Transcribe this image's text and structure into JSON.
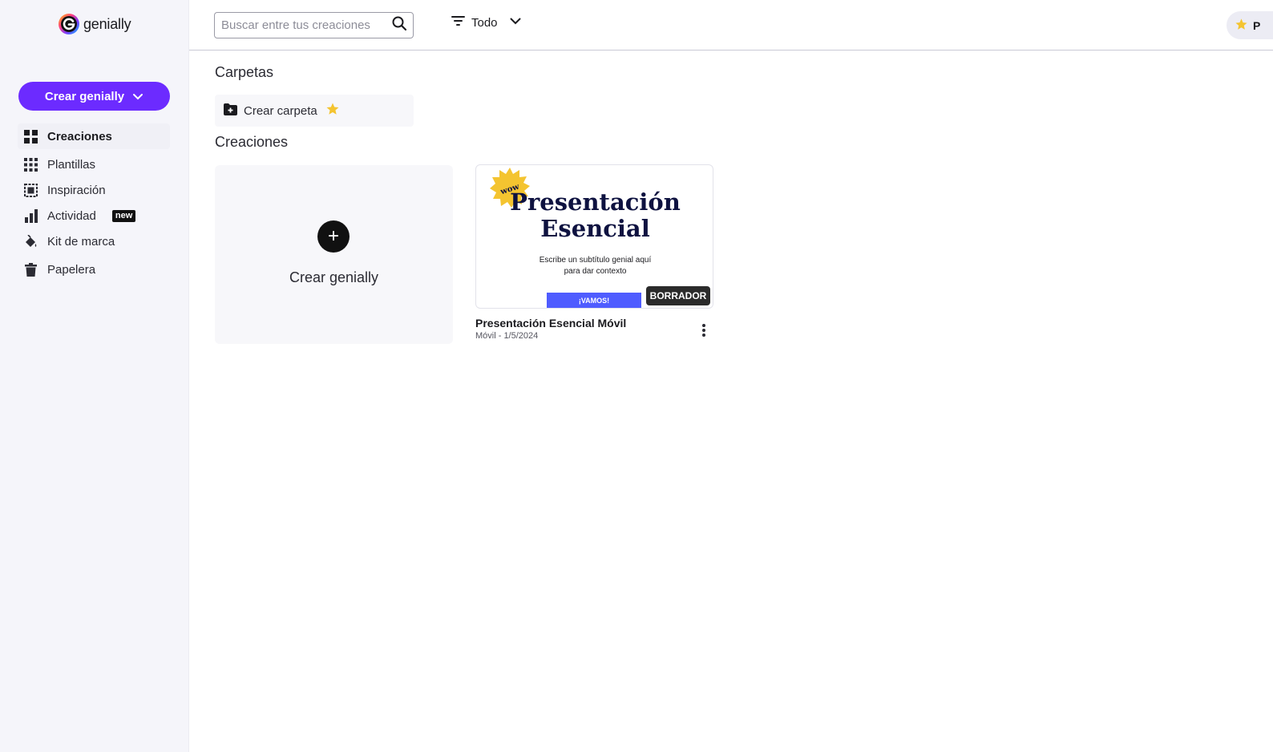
{
  "brand": {
    "name": "genially",
    "icon": "genially-logo-icon"
  },
  "sidebar": {
    "create_button": {
      "label": "Crear genially",
      "icon": "chevron-down-icon"
    },
    "items": [
      {
        "label": "Creaciones",
        "icon": "grid-icon",
        "active": true
      },
      {
        "label": "Plantillas",
        "icon": "dots-grid-icon"
      },
      {
        "label": "Inspiración",
        "icon": "gallery-icon"
      },
      {
        "label": "Actividad",
        "icon": "bar-chart-icon",
        "badge": "new"
      },
      {
        "label": "Kit de marca",
        "icon": "paint-bucket-icon"
      },
      {
        "label": "Papelera",
        "icon": "trash-icon"
      }
    ]
  },
  "topbar": {
    "search": {
      "placeholder": "Buscar entre tus creaciones",
      "value": ""
    },
    "filter": {
      "label": "Todo",
      "icon": "filter-icon"
    },
    "premium": {
      "icon": "star-icon",
      "label": "P"
    }
  },
  "main": {
    "folders_title": "Carpetas",
    "create_folder": {
      "label": "Crear carpeta",
      "icon": "folder-plus-icon",
      "premium_icon": "star-icon"
    },
    "creations_title": "Creaciones",
    "create_card": {
      "label": "Crear genially",
      "plus": "+"
    },
    "creations": [
      {
        "name": "Presentación Esencial Móvil",
        "meta": "Móvil - 1/5/2024",
        "status": "BORRADOR",
        "thumbnail": {
          "sticker": "wow",
          "title_line1": "Presentación",
          "title_line2": "Esencial",
          "subtitle_line1": "Escribe un subtítulo genial aquí",
          "subtitle_line2": "para dar contexto",
          "cta": "¡VAMOS!"
        }
      }
    ]
  },
  "colors": {
    "accent": "#6c2bff",
    "sidebar_bg": "#f5f5fa",
    "thumb_title": "#0e1240",
    "thumb_cta": "#4f5cff",
    "star": "#f4c430"
  }
}
